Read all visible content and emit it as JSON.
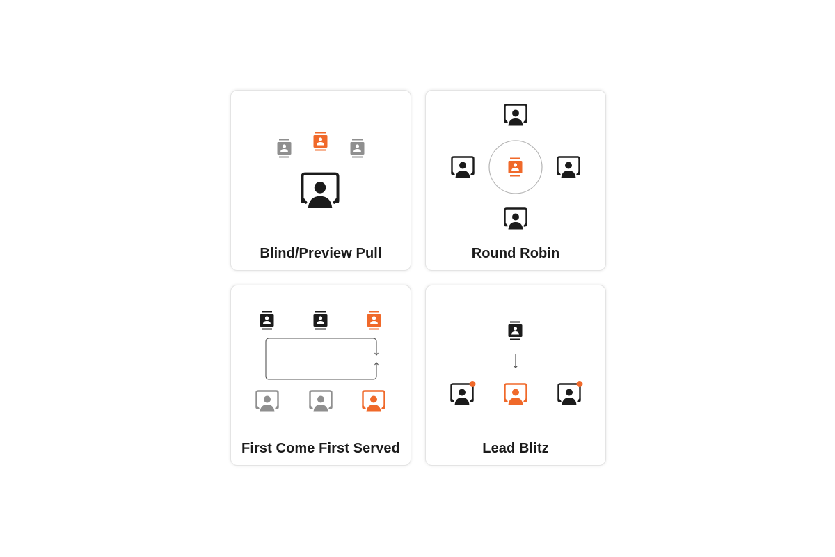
{
  "colors": {
    "accent": "#f0692a",
    "dark": "#1b1b1b",
    "muted": "#8f8f8f",
    "ring": "#b5b5b5",
    "line": "#555555"
  },
  "cards": [
    {
      "title": "Blind/Preview Pull",
      "leads": [
        {
          "icon": "lead-card-icon",
          "state": "muted"
        },
        {
          "icon": "lead-card-icon",
          "state": "accent"
        },
        {
          "icon": "lead-card-icon",
          "state": "muted"
        }
      ],
      "agents": [
        {
          "icon": "agent-monitor-icon",
          "state": "dark"
        }
      ]
    },
    {
      "title": "Round Robin",
      "center_lead": {
        "icon": "lead-card-icon",
        "state": "accent"
      },
      "agents": [
        {
          "icon": "agent-monitor-icon",
          "state": "dark",
          "position": "top"
        },
        {
          "icon": "agent-monitor-icon",
          "state": "dark",
          "position": "left"
        },
        {
          "icon": "agent-monitor-icon",
          "state": "dark",
          "position": "right"
        },
        {
          "icon": "agent-monitor-icon",
          "state": "dark",
          "position": "bottom"
        }
      ]
    },
    {
      "title": "First Come First Served",
      "leads": [
        {
          "icon": "lead-card-icon",
          "state": "dark"
        },
        {
          "icon": "lead-card-icon",
          "state": "dark"
        },
        {
          "icon": "lead-card-icon",
          "state": "accent"
        }
      ],
      "agents": [
        {
          "icon": "agent-monitor-icon",
          "state": "muted"
        },
        {
          "icon": "agent-monitor-icon",
          "state": "muted"
        },
        {
          "icon": "agent-monitor-icon",
          "state": "accent"
        }
      ]
    },
    {
      "title": "Lead Blitz",
      "leads": [
        {
          "icon": "lead-card-icon",
          "state": "dark"
        }
      ],
      "agents": [
        {
          "icon": "agent-monitor-icon",
          "state": "dark",
          "notification": true
        },
        {
          "icon": "agent-monitor-icon",
          "state": "accent",
          "notification": false
        },
        {
          "icon": "agent-monitor-icon",
          "state": "dark",
          "notification": true
        }
      ]
    }
  ]
}
